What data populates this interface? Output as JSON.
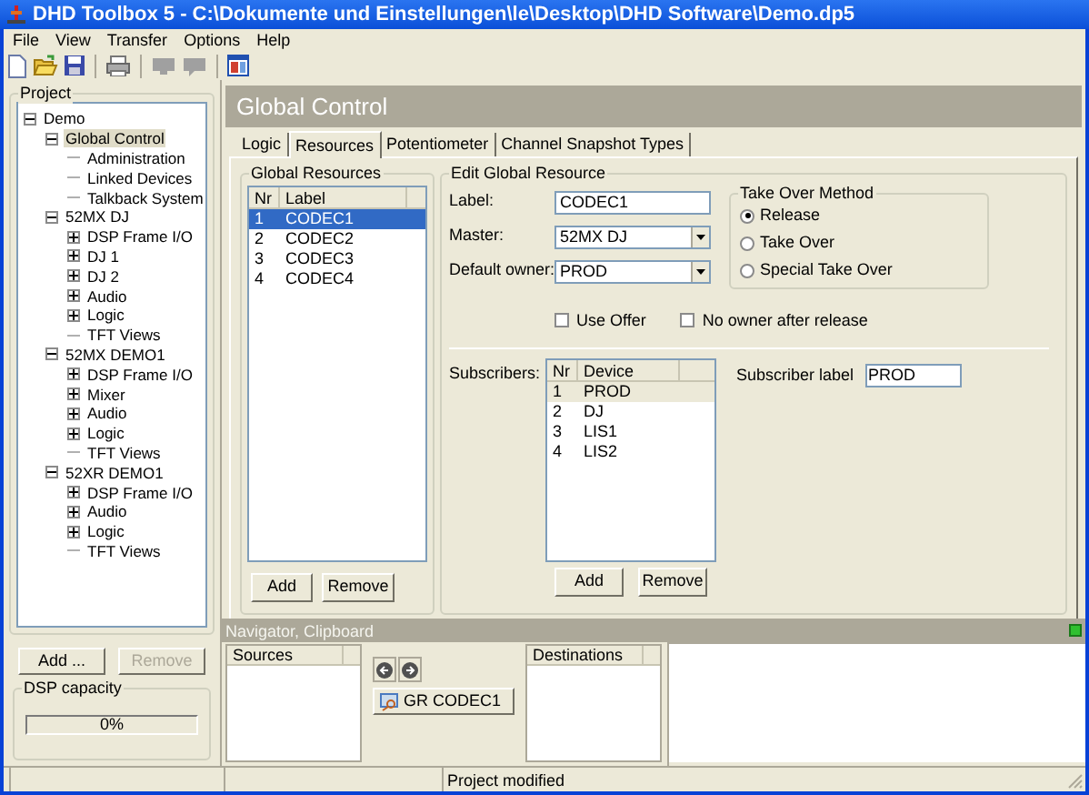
{
  "window": {
    "title": "DHD Toolbox 5 - C:\\Dokumente und Einstellungen\\le\\Desktop\\DHD Software\\Demo.dp5"
  },
  "menu": [
    "File",
    "View",
    "Transfer",
    "Options",
    "Help"
  ],
  "project_panel": {
    "title": "Project",
    "tree": [
      {
        "label": "Demo",
        "expanded": true,
        "selected": false,
        "children": [
          {
            "label": "Global Control",
            "expanded": true,
            "selected": true,
            "children": [
              {
                "label": "Administration",
                "selected": false
              },
              {
                "label": "Linked Devices",
                "selected": false
              },
              {
                "label": "Talkback System",
                "selected": false
              }
            ]
          },
          {
            "label": "52MX DJ",
            "expanded": true,
            "selected": false,
            "children": [
              {
                "label": "DSP Frame I/O",
                "expanded": false,
                "selected": false
              },
              {
                "label": "DJ 1",
                "expanded": false,
                "selected": false
              },
              {
                "label": "DJ 2",
                "expanded": false,
                "selected": false
              },
              {
                "label": "Audio",
                "expanded": false,
                "selected": false
              },
              {
                "label": "Logic",
                "expanded": false,
                "selected": false
              },
              {
                "label": "TFT Views",
                "selected": false
              }
            ]
          },
          {
            "label": "52MX DEMO1",
            "expanded": true,
            "selected": false,
            "children": [
              {
                "label": "DSP Frame I/O",
                "expanded": false,
                "selected": false
              },
              {
                "label": "Mixer",
                "expanded": false,
                "selected": false
              },
              {
                "label": "Audio",
                "expanded": false,
                "selected": false
              },
              {
                "label": "Logic",
                "expanded": false,
                "selected": false
              },
              {
                "label": "TFT Views",
                "selected": false
              }
            ]
          },
          {
            "label": "52XR DEMO1",
            "expanded": true,
            "selected": false,
            "children": [
              {
                "label": "DSP Frame I/O",
                "expanded": false,
                "selected": false
              },
              {
                "label": "Audio",
                "expanded": false,
                "selected": false
              },
              {
                "label": "Logic",
                "expanded": false,
                "selected": false
              },
              {
                "label": "TFT Views",
                "selected": false
              }
            ]
          }
        ]
      }
    ],
    "buttons": [
      {
        "label": "Add ...",
        "disabled": false
      },
      {
        "label": "Remove",
        "disabled": true
      }
    ],
    "dsp_capacity": {
      "title": "DSP capacity",
      "level": 0,
      "reading": "0%"
    }
  },
  "header": {
    "title": "Global Control"
  },
  "tabs": [
    {
      "label": "Logic",
      "selected": false
    },
    {
      "label": "Resources",
      "selected": true
    },
    {
      "label": "Potentiometer",
      "selected": false
    },
    {
      "label": "Channel Snapshot Types",
      "selected": false
    }
  ],
  "global_resources": {
    "title": "Global Resources",
    "columns": [
      "Nr",
      "Label"
    ],
    "rows": [
      {
        "cells": [
          "1",
          "CODEC1"
        ],
        "selected": true
      },
      {
        "cells": [
          "2",
          "CODEC2"
        ],
        "selected": false
      },
      {
        "cells": [
          "3",
          "CODEC3"
        ],
        "selected": false
      },
      {
        "cells": [
          "4",
          "CODEC4"
        ],
        "selected": false
      }
    ],
    "buttons": [
      "Add",
      "Remove"
    ]
  },
  "edit_resource": {
    "title": "Edit Global Resource",
    "fields": [
      {
        "kind": "text",
        "label": "Label:",
        "value": "CODEC1"
      },
      {
        "kind": "dropdown",
        "label": "Master:",
        "value": "52MX DJ"
      },
      {
        "kind": "dropdown",
        "label": "Default owner:",
        "value": "PROD"
      }
    ],
    "checkboxes": [
      {
        "label": "Use Offer",
        "checked": false
      },
      {
        "label": "No owner after release",
        "checked": false
      }
    ],
    "take_over_method": {
      "title": "Take Over Method",
      "options": [
        {
          "label": "Release",
          "selected": true
        },
        {
          "label": "Take Over",
          "selected": false
        },
        {
          "label": "Special Take Over",
          "selected": false
        }
      ]
    },
    "subscribers": {
      "label": "Subscribers:",
      "columns": [
        "Nr",
        "Device"
      ],
      "rows": [
        {
          "cells": [
            "1",
            "PROD"
          ],
          "selected": true
        },
        {
          "cells": [
            "2",
            "DJ"
          ],
          "selected": false
        },
        {
          "cells": [
            "3",
            "LIS1"
          ],
          "selected": false
        },
        {
          "cells": [
            "4",
            "LIS2"
          ],
          "selected": false
        }
      ],
      "buttons": [
        "Add",
        "Remove"
      ]
    },
    "subscriber_label": {
      "label": "Subscriber label",
      "value": "PROD"
    }
  },
  "navigator": {
    "title": "Navigator, Clipboard",
    "sources": {
      "columns": [
        "Sources"
      ]
    },
    "destinations": {
      "columns": [
        "Destinations"
      ]
    },
    "clipboard_item": "GR CODEC1"
  },
  "status_bar": {
    "message": "Project modified"
  }
}
